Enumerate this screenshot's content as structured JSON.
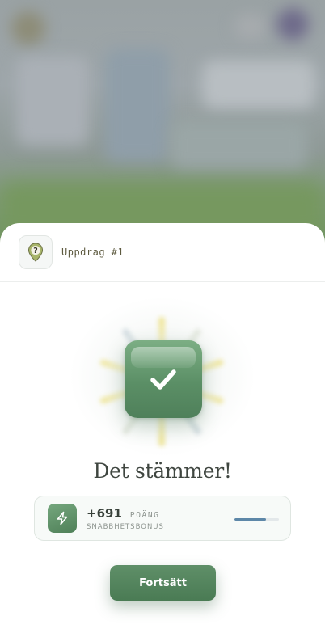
{
  "mission": {
    "title": "Uppdrag #1",
    "badge_symbol": "?",
    "badge_icon": "map-pin-icon"
  },
  "result": {
    "title": "Det stämmer!",
    "icon": "checkmark-icon"
  },
  "score": {
    "value": "+691",
    "unit": "POÄNG",
    "label": "SNABBHETSBONUS",
    "icon": "lightning-icon",
    "speed_bonus_fraction": 0.7
  },
  "actions": {
    "continue_label": "Fortsätt"
  },
  "colors": {
    "accent_green": "#5b8f66",
    "progress_blue": "#5d87a8"
  }
}
